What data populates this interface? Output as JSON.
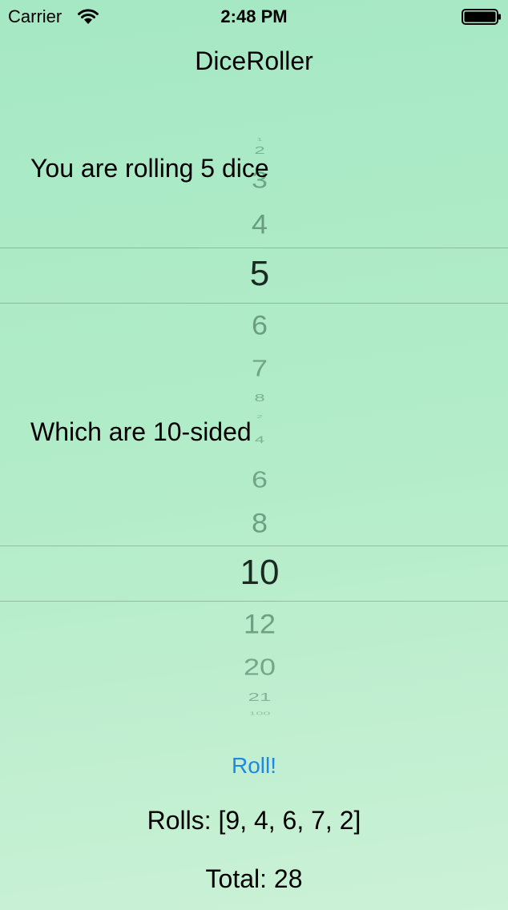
{
  "status_bar": {
    "carrier": "Carrier",
    "time": "2:48 PM"
  },
  "nav": {
    "title": "DiceRoller"
  },
  "dice_count_label": "You are rolling 5 dice",
  "dice_sides_label": "Which are 10-sided",
  "count_picker": {
    "selected": "5",
    "items": [
      "1",
      "2",
      "3",
      "4",
      "5",
      "6",
      "7",
      "8"
    ]
  },
  "sides_picker": {
    "selected": "10",
    "items": [
      "2",
      "4",
      "6",
      "8",
      "10",
      "12",
      "20",
      "21",
      "100"
    ]
  },
  "roll_button": "Roll!",
  "rolls_text": "Rolls: [9, 4, 6, 7, 2]",
  "total_text": "Total: 28",
  "colors": {
    "accent": "#1e88e5",
    "background_top": "#a6e8c4",
    "background_bottom": "#cbf1d6"
  }
}
